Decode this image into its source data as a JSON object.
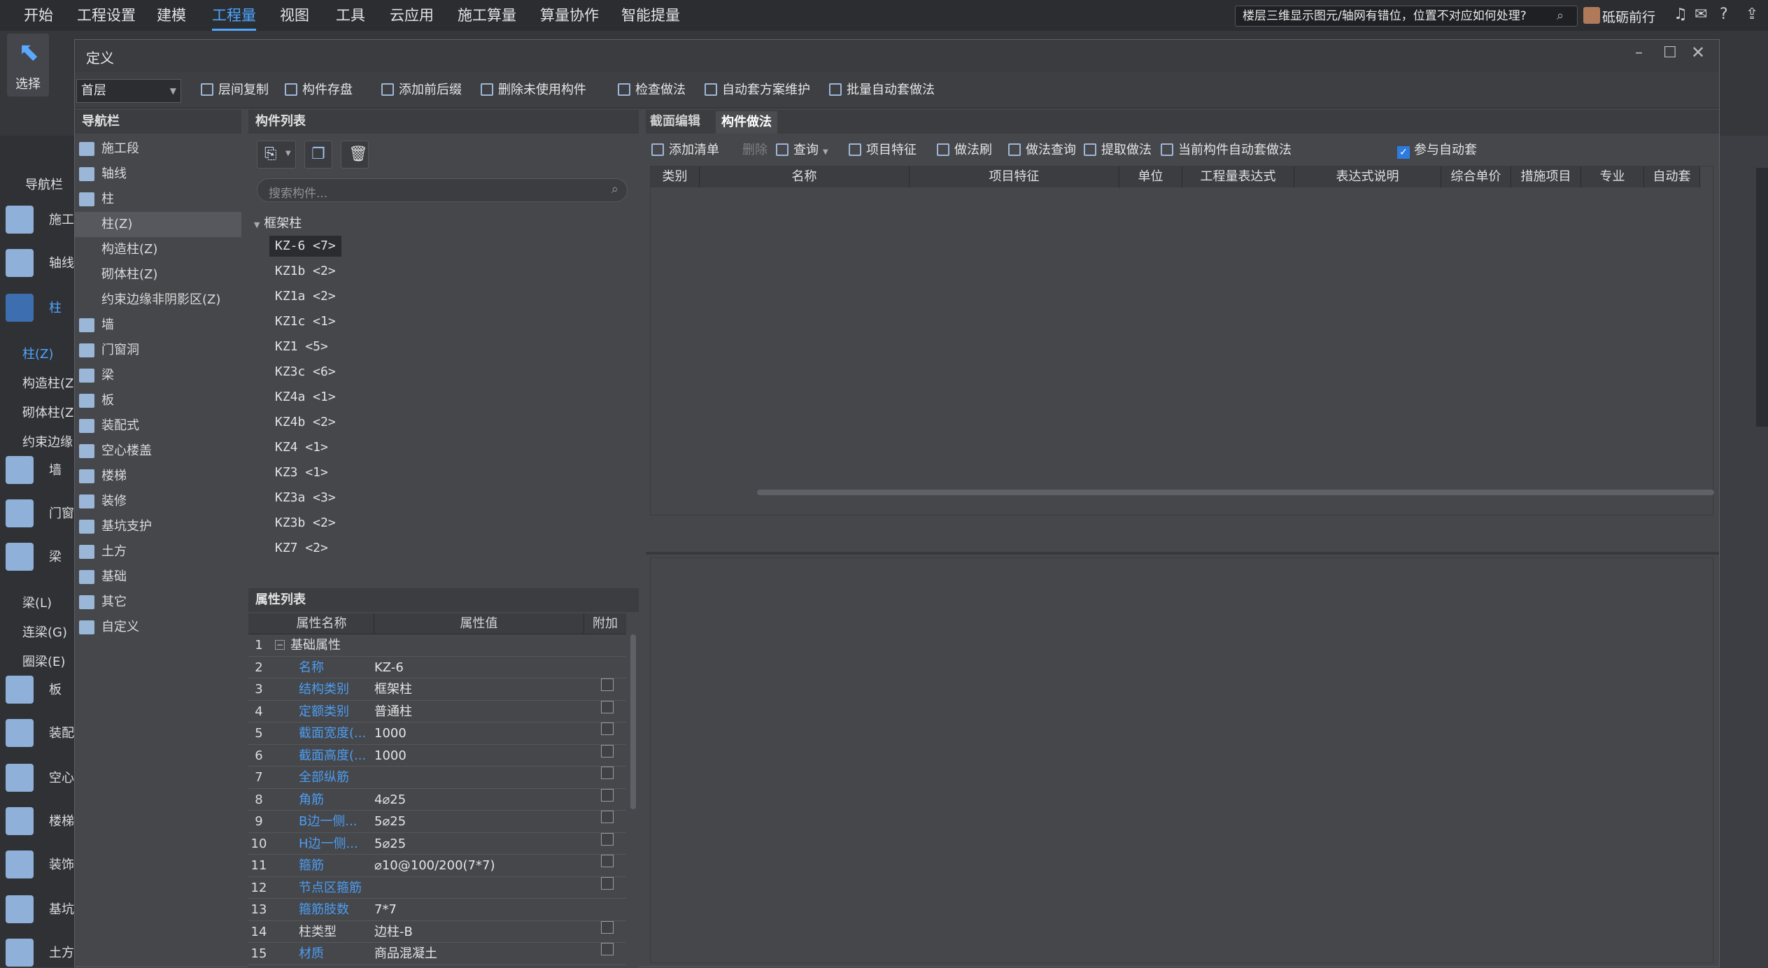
{
  "menu": {
    "items": [
      "开始",
      "工程设置",
      "建模",
      "工程量",
      "视图",
      "工具",
      "云应用",
      "施工算量",
      "算量协作",
      "智能提量"
    ],
    "active": "工程量",
    "help_search": "楼层三维显示图元/轴网有错位，位置不对应如何处理?",
    "user": "砥砺前行",
    "help_label": "?"
  },
  "ribbon": {
    "select_label": "选择"
  },
  "left_sidebar": {
    "floor": "首层",
    "nav_label": "导航栏",
    "items": [
      "施工",
      "轴线",
      "柱",
      "墙",
      "门窗",
      "梁",
      "板",
      "装配",
      "空心",
      "楼梯",
      "装饰",
      "基坑",
      "土方"
    ],
    "column_sub": [
      "柱(Z)",
      "构造柱(Z",
      "砌体柱(Z",
      "约束边缘"
    ],
    "beam_sub": [
      "梁(L)",
      "连梁(G)",
      "圈梁(E)"
    ]
  },
  "dialog": {
    "title": "定义",
    "floor_select": "首层",
    "toolbar": [
      "层间复制",
      "构件存盘",
      "添加前后缀",
      "删除未使用构件",
      "检查做法",
      "自动套方案维护",
      "批量自动套做法"
    ]
  },
  "nav": {
    "title": "导航栏",
    "items": [
      {
        "label": "施工段",
        "sub": false,
        "icon": "construction-section-icon"
      },
      {
        "label": "轴线",
        "sub": false,
        "icon": "axis-icon"
      },
      {
        "label": "柱",
        "sub": false,
        "icon": "column-icon"
      },
      {
        "label": "柱(Z)",
        "sub": true,
        "selected": true
      },
      {
        "label": "构造柱(Z)",
        "sub": true
      },
      {
        "label": "砌体柱(Z)",
        "sub": true
      },
      {
        "label": "约束边缘非阴影区(Z)",
        "sub": true
      },
      {
        "label": "墙",
        "sub": false,
        "icon": "wall-icon"
      },
      {
        "label": "门窗洞",
        "sub": false,
        "icon": "door-window-icon"
      },
      {
        "label": "梁",
        "sub": false,
        "icon": "beam-icon"
      },
      {
        "label": "板",
        "sub": false,
        "icon": "slab-icon"
      },
      {
        "label": "装配式",
        "sub": false,
        "icon": "prefab-icon"
      },
      {
        "label": "空心楼盖",
        "sub": false,
        "icon": "hollow-floor-icon"
      },
      {
        "label": "楼梯",
        "sub": false,
        "icon": "stair-icon"
      },
      {
        "label": "装修",
        "sub": false,
        "icon": "decoration-icon"
      },
      {
        "label": "基坑支护",
        "sub": false,
        "icon": "pit-support-icon"
      },
      {
        "label": "土方",
        "sub": false,
        "icon": "earthwork-icon"
      },
      {
        "label": "基础",
        "sub": false,
        "icon": "foundation-icon"
      },
      {
        "label": "其它",
        "sub": false,
        "icon": "other-icon"
      },
      {
        "label": "自定义",
        "sub": false,
        "icon": "custom-icon"
      }
    ]
  },
  "components": {
    "title": "构件列表",
    "search_placeholder": "搜索构件...",
    "group": "框架柱",
    "items": [
      "KZ-6 <7>",
      "KZ1b <2>",
      "KZ1a <2>",
      "KZ1c <1>",
      "KZ1 <5>",
      "KZ3c <6>",
      "KZ4a <1>",
      "KZ4b <2>",
      "KZ4 <1>",
      "KZ3 <1>",
      "KZ3a <3>",
      "KZ3b <2>",
      "KZ7 <2>"
    ]
  },
  "properties": {
    "title": "属性列表",
    "headers": [
      "属性名称",
      "属性值",
      "附加"
    ],
    "rows": [
      {
        "n": "1",
        "name": "基础属性",
        "value": "",
        "chk": false,
        "group": true
      },
      {
        "n": "2",
        "name": "名称",
        "value": "KZ-6",
        "chk": false
      },
      {
        "n": "3",
        "name": "结构类别",
        "value": "框架柱",
        "chk": true
      },
      {
        "n": "4",
        "name": "定额类别",
        "value": "普通柱",
        "chk": true
      },
      {
        "n": "5",
        "name": "截面宽度(...",
        "value": "1000",
        "chk": true
      },
      {
        "n": "6",
        "name": "截面高度(...",
        "value": "1000",
        "chk": true
      },
      {
        "n": "7",
        "name": "全部纵筋",
        "value": "",
        "chk": true
      },
      {
        "n": "8",
        "name": "角筋",
        "value": "4⌀25",
        "chk": true
      },
      {
        "n": "9",
        "name": "B边一侧...",
        "value": "5⌀25",
        "chk": true
      },
      {
        "n": "10",
        "name": "H边一侧...",
        "value": "5⌀25",
        "chk": true
      },
      {
        "n": "11",
        "name": "箍筋",
        "value": "⌀10@100/200(7*7)",
        "chk": true
      },
      {
        "n": "12",
        "name": "节点区箍筋",
        "value": "",
        "chk": true
      },
      {
        "n": "13",
        "name": "箍筋肢数",
        "value": "7*7",
        "chk": false
      },
      {
        "n": "14",
        "name": "柱类型",
        "value": "边柱-B",
        "chk": true,
        "plain": true
      },
      {
        "n": "15",
        "name": "材质",
        "value": "商品混凝土",
        "chk": true
      }
    ]
  },
  "right": {
    "tabs": [
      "截面编辑",
      "构件做法"
    ],
    "active_tab": "构件做法",
    "toolbar": [
      "添加清单",
      "删除",
      "查询",
      "项目特征",
      "做法刷",
      "做法查询",
      "提取做法",
      "当前构件自动套做法",
      "参与自动套"
    ],
    "auto_checked": true,
    "columns": [
      "类别",
      "名称",
      "项目特征",
      "单位",
      "工程量表达式",
      "表达式说明",
      "综合单价",
      "措施项目",
      "专业",
      "自动套"
    ]
  }
}
